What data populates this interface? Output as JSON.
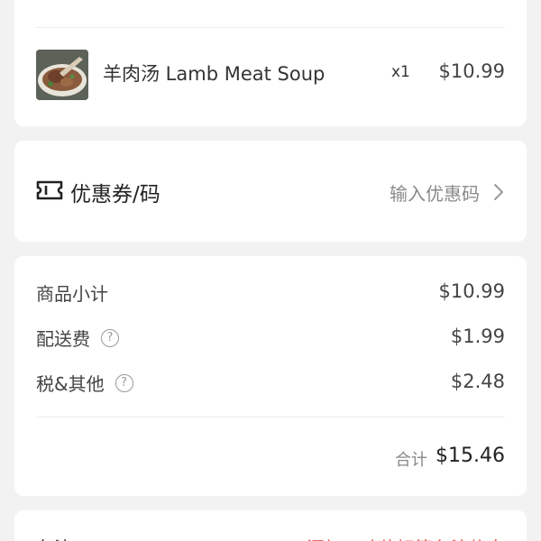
{
  "order_item": {
    "name": "羊肉汤 Lamb Meat Soup",
    "quantity": "x1",
    "price": "$10.99",
    "thumbnail_icon": "lamb-soup-photo"
  },
  "coupon": {
    "icon": "ticket-icon",
    "label": "优惠券/码",
    "input_text": "输入优惠码",
    "chevron_icon": "chevron-right-icon"
  },
  "summary": {
    "subtotal_label": "商品小计",
    "subtotal_value": "$10.99",
    "delivery_label": "配送费",
    "delivery_value": "$1.99",
    "tax_label": "税&其他",
    "tax_value": "$2.48",
    "help_icon": "?",
    "total_label": "合计",
    "total_value": "$15.46"
  },
  "notes": {
    "label": "备注",
    "hint": "添加口味偏好等备注信息"
  },
  "colors": {
    "accent_red": "#e0594f",
    "background": "#f2f2f2",
    "card": "#ffffff"
  }
}
